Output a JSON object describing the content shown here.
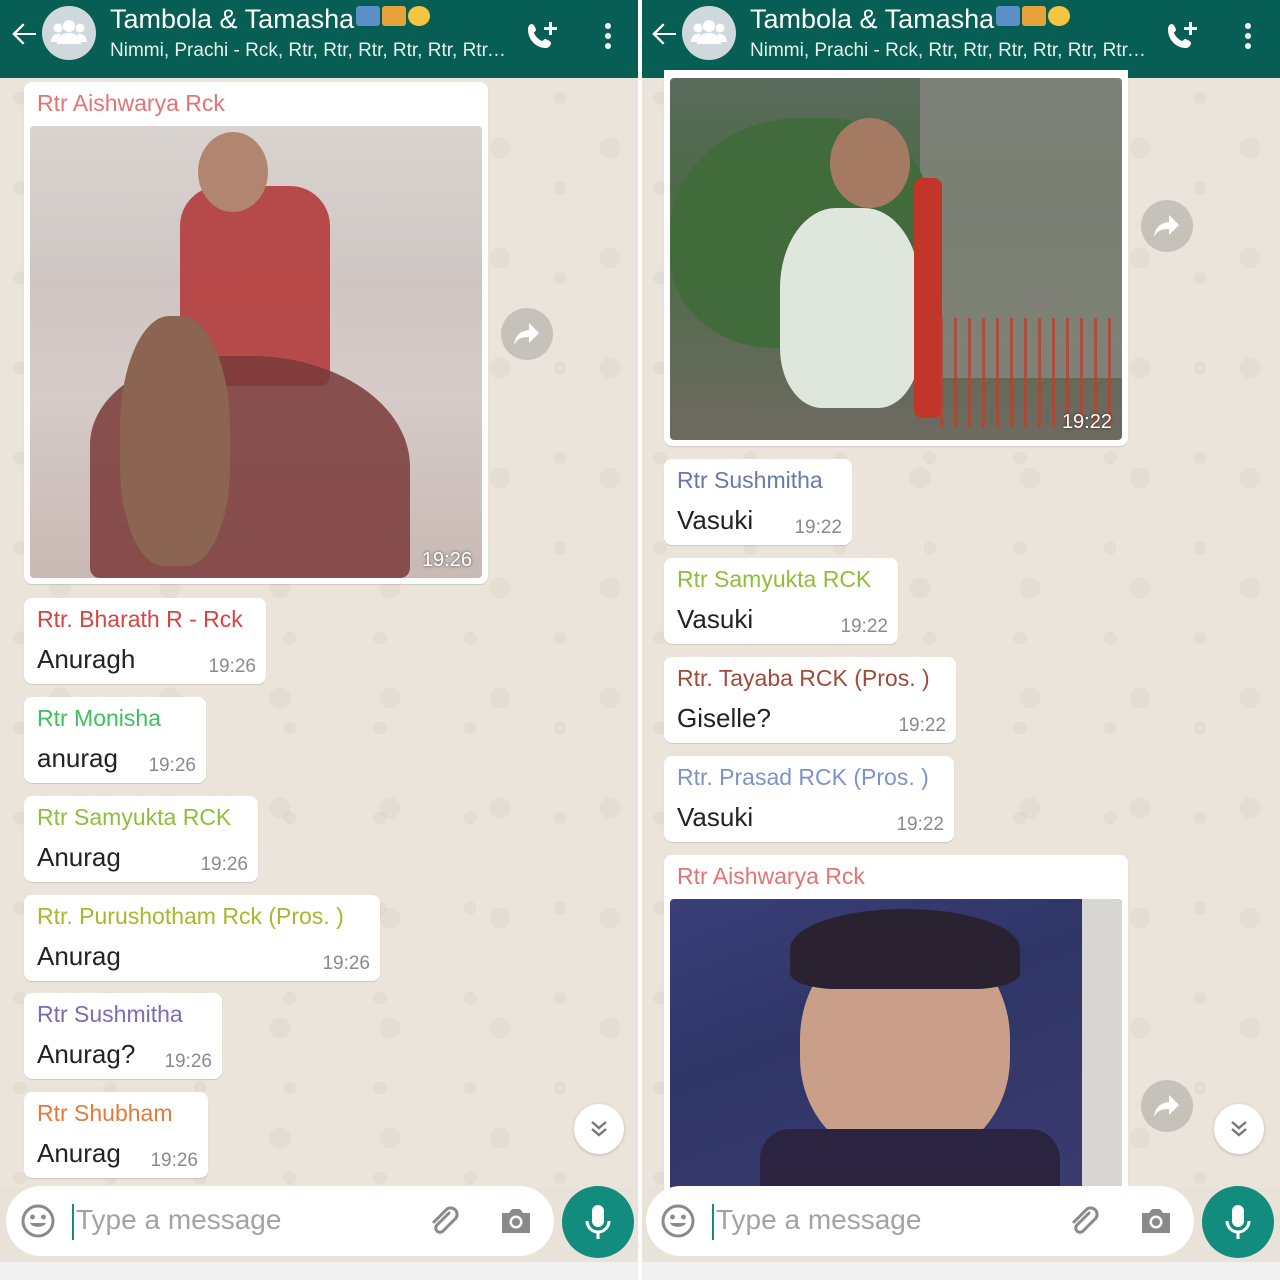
{
  "chat": {
    "title": "Tambola & Tamasha",
    "subtitle": "Nimmi, Prachi - Rck, Rtr, Rtr, Rtr, Rtr, Rtr, Rtr, Rtr...",
    "input_placeholder": "Type a message"
  },
  "colors": {
    "header": "#075e54",
    "accent": "#128c7e",
    "bubble": "#ffffff",
    "wallpaper": "#ebe4da"
  },
  "left_panel": {
    "messages": [
      {
        "sender": "Rtr Aishwarya Rck",
        "sender_color": "#e57373",
        "type": "image",
        "time": "19:26",
        "image_desc": "boy-on-horse-photo"
      },
      {
        "sender": "Rtr. Bharath R - Rck",
        "sender_color": "#d84343",
        "text": "Anuragh",
        "time": "19:26"
      },
      {
        "sender": "Rtr Monisha",
        "sender_color": "#3fbf5f",
        "text": "anurag",
        "time": "19:26"
      },
      {
        "sender": "Rtr Samyukta RCK",
        "sender_color": "#8fbf3a",
        "text": "Anurag",
        "time": "19:26"
      },
      {
        "sender": "Rtr. Purushotham Rck (Pros. )",
        "sender_color": "#a8b82c",
        "text": "Anurag",
        "time": "19:26"
      },
      {
        "sender": "Rtr Sushmitha",
        "sender_color": "#7a6bb8",
        "text": "Anurag?",
        "time": "19:26"
      },
      {
        "sender": "Rtr Shubham",
        "sender_color": "#e5793a",
        "text": "Anurag",
        "time": "19:26"
      }
    ]
  },
  "right_panel": {
    "messages": [
      {
        "type": "image",
        "time": "19:22",
        "image_desc": "toddler-in-garden-photo"
      },
      {
        "sender": "Rtr Sushmitha",
        "sender_color": "#6a78a8",
        "text": "Vasuki",
        "time": "19:22"
      },
      {
        "sender": "Rtr Samyukta RCK",
        "sender_color": "#8fbf3a",
        "text": "Vasuki",
        "time": "19:22"
      },
      {
        "sender": "Rtr. Tayaba RCK (Pros. )",
        "sender_color": "#a04a3a",
        "text": "Giselle?",
        "time": "19:22"
      },
      {
        "sender": "Rtr. Prasad RCK (Pros. )",
        "sender_color": "#7a94c8",
        "text": "Vasuki",
        "time": "19:22"
      },
      {
        "sender": "Rtr Aishwarya Rck",
        "sender_color": "#e57373",
        "type": "image",
        "image_desc": "baby-portrait-photo"
      }
    ]
  }
}
